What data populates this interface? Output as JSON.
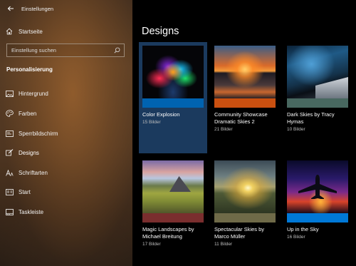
{
  "window": {
    "title": "Einstellungen"
  },
  "sidebar": {
    "home_label": "Startseite",
    "search_placeholder": "Einstellung suchen",
    "section_title": "Personalisierung",
    "items": [
      {
        "label": "Hintergrund",
        "icon": "image-icon"
      },
      {
        "label": "Farben",
        "icon": "palette-icon"
      },
      {
        "label": "Sperrbildschirm",
        "icon": "lock-screen-icon"
      },
      {
        "label": "Designs",
        "icon": "brush-icon",
        "active": true
      },
      {
        "label": "Schriftarten",
        "icon": "font-icon"
      },
      {
        "label": "Start",
        "icon": "start-icon"
      },
      {
        "label": "Taskleiste",
        "icon": "taskbar-icon"
      }
    ]
  },
  "main": {
    "title": "Designs",
    "themes": [
      {
        "title": "Color Explosion",
        "count": "15 Bilder",
        "accent": "#0063b1",
        "selected": true
      },
      {
        "title": "Community Showcase Dramatic Skies 2",
        "count": "21 Bilder",
        "accent": "#ca5010"
      },
      {
        "title": "Dark Skies by Tracy Hymas",
        "count": "10 Bilder",
        "accent": "#486860"
      },
      {
        "title": "Magic Landscapes by Michael Breitung",
        "count": "17 Bilder",
        "accent": "#7a2e2e"
      },
      {
        "title": "Spectacular Skies by Marco Müller",
        "count": "11 Bilder",
        "accent": "#6f6a48"
      },
      {
        "title": "Up in the Sky",
        "count": "16 Bilder",
        "accent": "#0078d7"
      }
    ]
  }
}
